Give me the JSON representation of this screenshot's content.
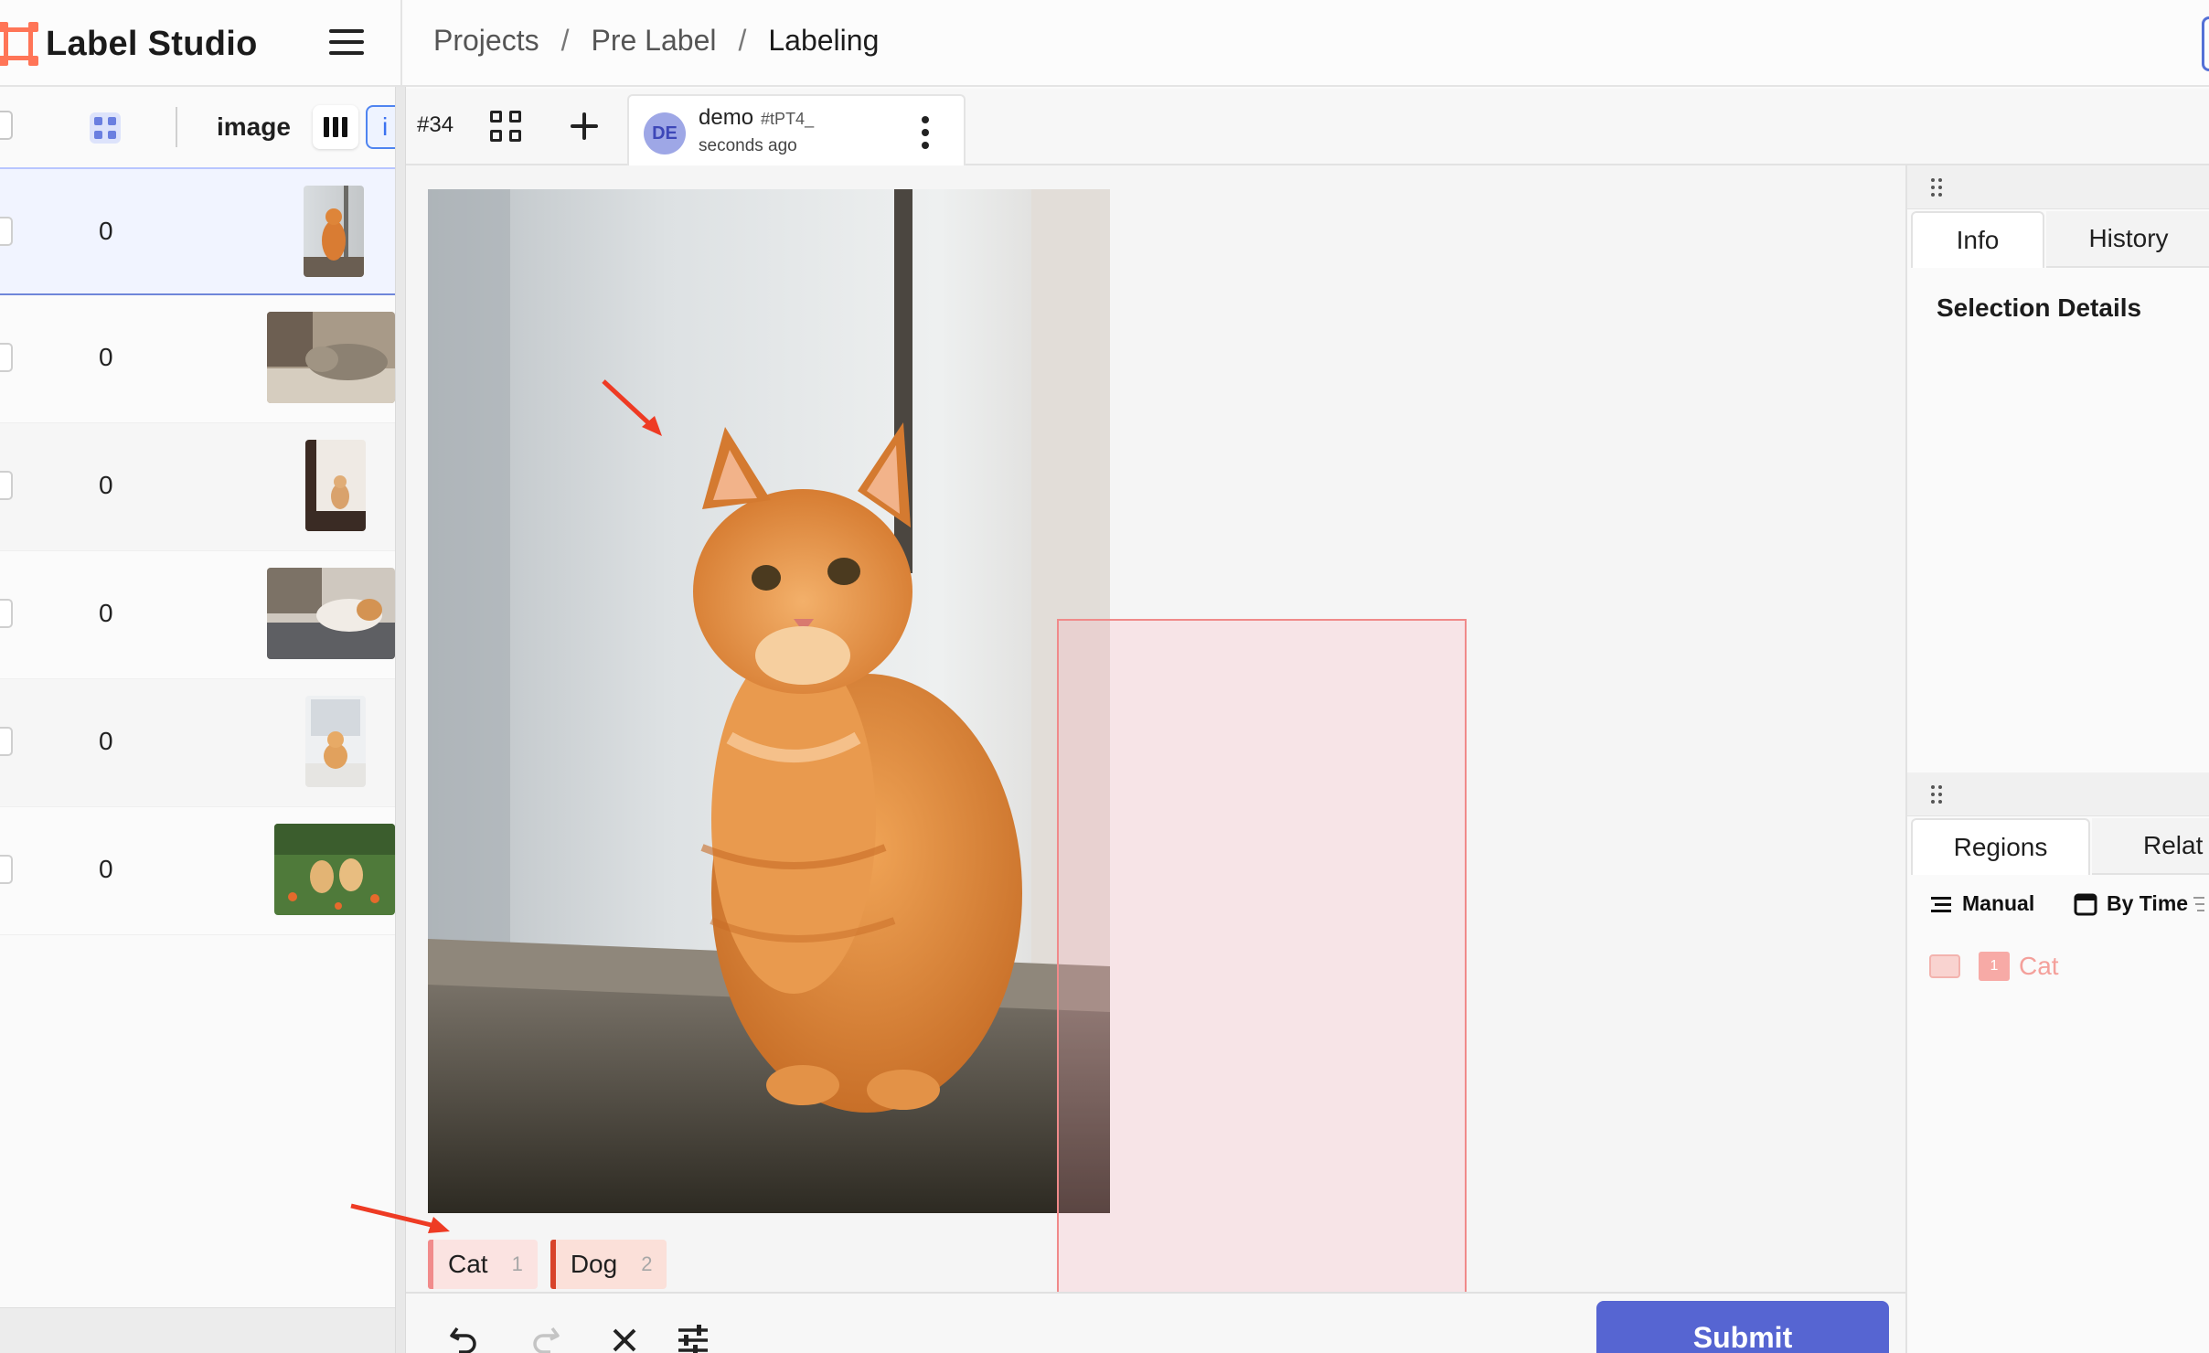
{
  "app": {
    "name": "Label Studio",
    "breadcrumb": [
      "Projects",
      "Pre Label",
      "Labeling"
    ]
  },
  "data_manager": {
    "column_image": "image",
    "info_button": "i",
    "rows": [
      {
        "annotations": "0",
        "thumb": "cat-sitting-window",
        "selected": true
      },
      {
        "annotations": "0",
        "thumb": "cat-sleeping"
      },
      {
        "annotations": "0",
        "thumb": "small-dog-standing"
      },
      {
        "annotations": "0",
        "thumb": "dog-on-bed"
      },
      {
        "annotations": "0",
        "thumb": "corgi-sitting"
      },
      {
        "annotations": "0",
        "thumb": "two-puppies-grass"
      }
    ]
  },
  "labeling": {
    "task_id": "#34",
    "annotation": {
      "avatar": "DE",
      "user": "demo",
      "id": "#tPT4_",
      "time": "seconds ago"
    },
    "labels": [
      {
        "name": "Cat",
        "hotkey": "1",
        "color": "#f18b8b"
      },
      {
        "name": "Dog",
        "hotkey": "2",
        "color": "#d8432a"
      }
    ],
    "submit_label": "Submit",
    "region_box_label": "Cat"
  },
  "side_panel": {
    "tabs_top": [
      "Info",
      "History"
    ],
    "selection_title": "Selection Details",
    "tabs_bottom": [
      "Regions",
      "Relat"
    ],
    "sort_manual": "Manual",
    "sort_by_time": "By Time",
    "regions": [
      {
        "index": "1",
        "label": "Cat"
      }
    ]
  },
  "colors": {
    "accent": "#5665d2",
    "brand": "#ff7557",
    "cat_label": "#f18b8b",
    "dog_label": "#d8432a"
  }
}
